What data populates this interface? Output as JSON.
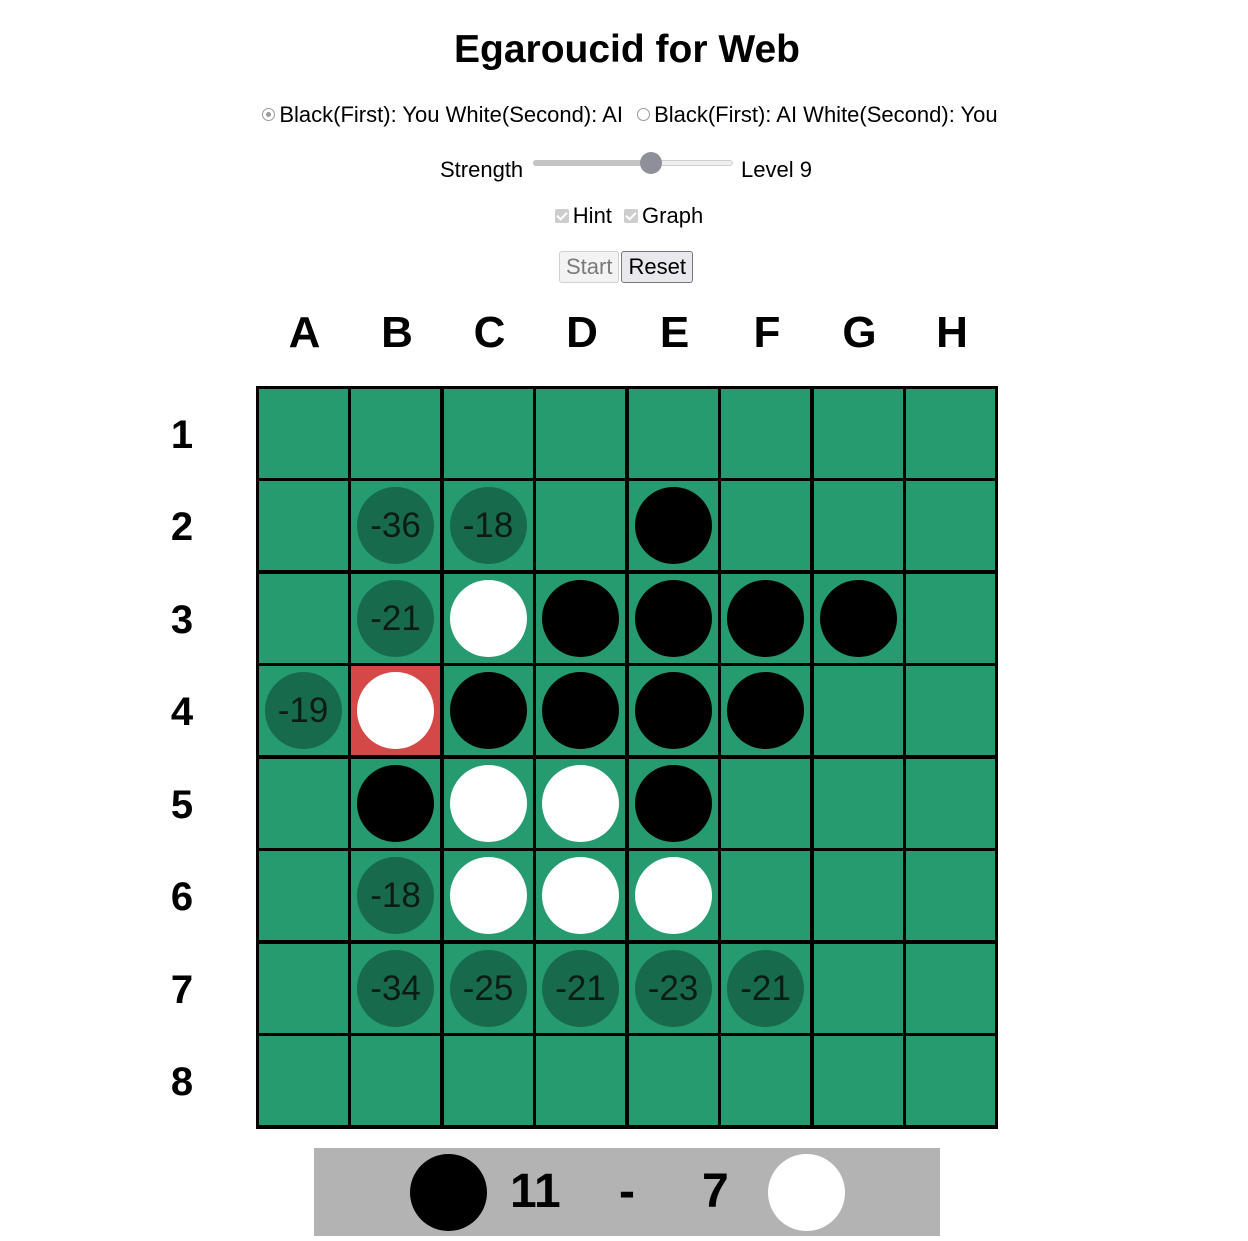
{
  "title": "Egaroucid for Web",
  "mode": {
    "options": [
      {
        "label": "Black(First): You White(Second): AI",
        "checked": true
      },
      {
        "label": "Black(First): AI White(Second): You",
        "checked": false
      }
    ]
  },
  "strength": {
    "label": "Strength",
    "value": 9,
    "min": 0,
    "max": 15,
    "level_text": "Level 9"
  },
  "options": {
    "hint": {
      "label": "Hint",
      "checked": true
    },
    "graph": {
      "label": "Graph",
      "checked": true
    }
  },
  "buttons": {
    "start": "Start",
    "reset": "Reset"
  },
  "board": {
    "columns": [
      "A",
      "B",
      "C",
      "D",
      "E",
      "F",
      "G",
      "H"
    ],
    "rows": [
      "1",
      "2",
      "3",
      "4",
      "5",
      "6",
      "7",
      "8"
    ],
    "grid": [
      [
        ".",
        ".",
        ".",
        ".",
        ".",
        ".",
        ".",
        "."
      ],
      [
        ".",
        "h:-36",
        "h:-18",
        ".",
        "B",
        ".",
        ".",
        "."
      ],
      [
        ".",
        "h:-21",
        "W",
        "B",
        "B",
        "B",
        "B",
        "."
      ],
      [
        "h:-19",
        "W",
        "B",
        "B",
        "B",
        "B",
        ".",
        "."
      ],
      [
        ".",
        "B",
        "W",
        "W",
        "B",
        ".",
        ".",
        "."
      ],
      [
        ".",
        "h:-18",
        "W",
        "W",
        "W",
        ".",
        ".",
        "."
      ],
      [
        ".",
        "h:-34",
        "h:-25",
        "h:-21",
        "h:-23",
        "h:-21",
        ".",
        "."
      ],
      [
        ".",
        ".",
        ".",
        ".",
        ".",
        ".",
        ".",
        "."
      ]
    ],
    "last_move": "B4",
    "colors": {
      "board": "#259b6f",
      "hint": "#176b4c",
      "last_move": "#d44848",
      "grid_line": "#000000"
    }
  },
  "score": {
    "black": "11",
    "separator": "-",
    "white": "7"
  }
}
